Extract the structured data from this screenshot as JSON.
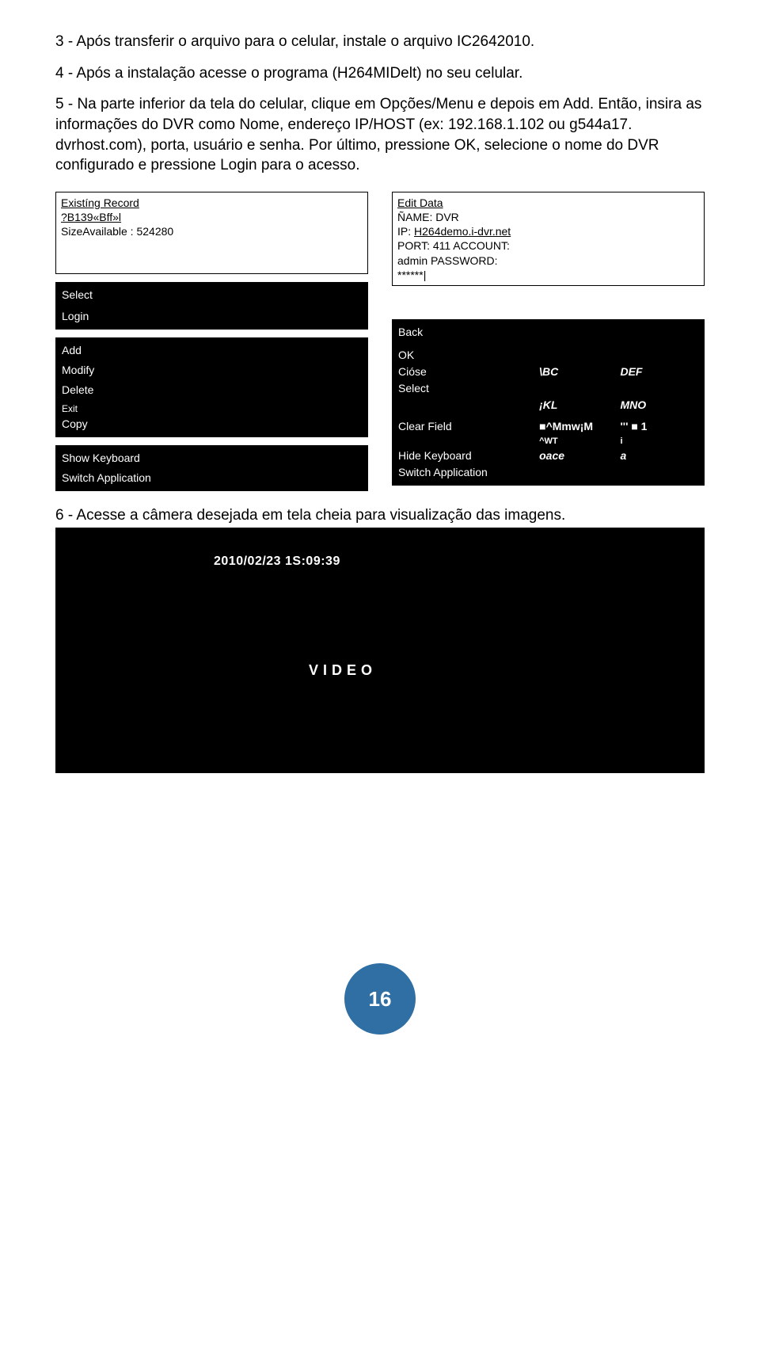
{
  "paragraphs": {
    "p3": "3 - Após transferir o arquivo para o celular, instale o arquivo IC2642010.",
    "p4": "4 - Após a instalação acesse o programa (H264MIDelt) no seu celular.",
    "p5": "5 - Na parte inferior da tela do celular, clique em Opções/Menu e depois em Add. Então, insira as informações do DVR como Nome, endereço IP/HOST (ex: 192.168.1.102 ou g544a17. dvrhost.com), porta, usuário e senha. Por último, pressione OK, selecione o nome do DVR configurado e pressione Login para o acesso.",
    "p6": "6 - Acesse a câmera desejada em tela cheia para visualização das imagens."
  },
  "left": {
    "panel_title": "Existíng Record",
    "panel_line2": "?B139«Bff»l",
    "panel_line3": "SizeAvailable : 524280",
    "menu": {
      "select": "Select",
      "login": "Login",
      "add": "Add",
      "modify": "Modify",
      "delete": "Delete",
      "exit": "Exit",
      "copy": "Copy",
      "show_kb": "Show Keyboard",
      "switch_app": "Switch Application"
    }
  },
  "right": {
    "panel_title": "Edit Data",
    "name_line": "ÑAME: DVR",
    "ip_prefix": "IP: ",
    "ip_value": "H264demo.i-dvr.net",
    "port_line": "PORT: 411 ACCOUNT:",
    "acct_line": "admin PASSWORD:",
    "pw_line": "******|",
    "menu": {
      "back": "Back",
      "ok": "OK",
      "ciose": "Cióse",
      "select": "Select",
      "clear": "Clear Field",
      "hide_kb": "Hide Keyboard",
      "switch_app": "Switch Application",
      "abc": "\\BC",
      "def": "DEF",
      "jkl": "¡KL",
      "mno": "MNO",
      "mmw": "■^Mmw¡M",
      "one": "''' ■ 1",
      "wt": "^WT",
      "i": "i",
      "oace": "oace",
      "a": "a"
    }
  },
  "video": {
    "timestamp": "2010/02/23 1S:09:39",
    "label": "VIDEO"
  },
  "page_number": "16"
}
